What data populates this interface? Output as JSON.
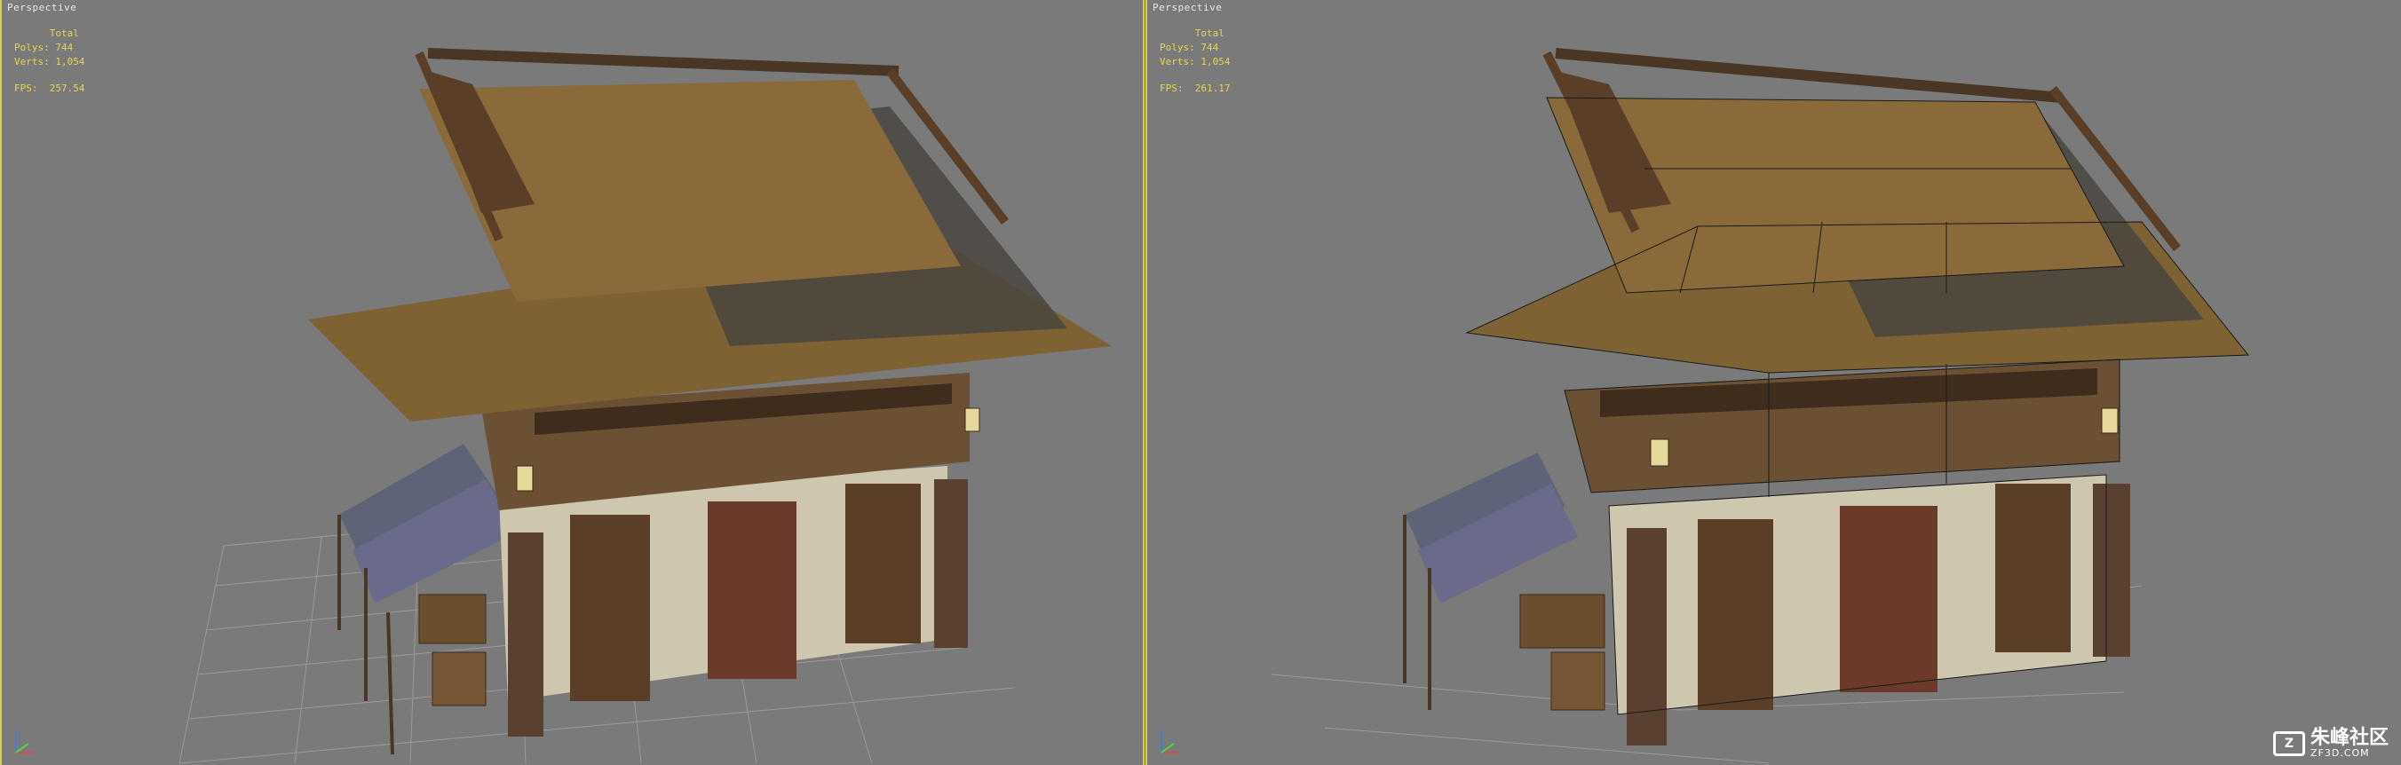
{
  "viewports": [
    {
      "label": "Perspective",
      "stats": {
        "header": "Total",
        "polys_label": "Polys:",
        "polys": "744",
        "verts_label": "Verts:",
        "verts": "1,054",
        "fps_label": "FPS:",
        "fps": "257.54"
      },
      "shading": "textured"
    },
    {
      "label": "Perspective",
      "stats": {
        "header": "Total",
        "polys_label": "Polys:",
        "polys": "744",
        "verts_label": "Verts:",
        "verts": "1,054",
        "fps_label": "FPS:",
        "fps": "261.17"
      },
      "shading": "textured-wireframe"
    }
  ],
  "watermark": {
    "name": "朱峰社区",
    "url": "ZF3D.COM",
    "logo": "Z"
  },
  "colors": {
    "viewport_bg": "#7a7a7a",
    "active_border": "#d9d04a",
    "stats_text": "#e8d64a",
    "grid": "#9a9a9a",
    "thatch": "#8a6a3a",
    "tile": "#4a4540",
    "wood": "#5a3e28",
    "plaster": "#cfc6b0",
    "awning": "#6a6a8a"
  },
  "icons": [
    "axis-gizmo-icon",
    "house-model"
  ]
}
